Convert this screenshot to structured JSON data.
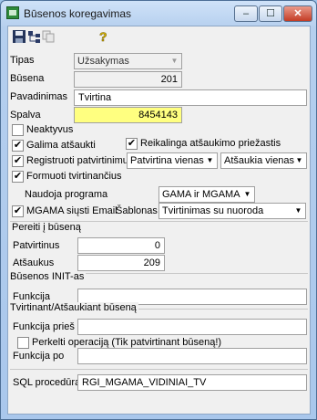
{
  "window": {
    "title": "Būsenos koregavimas",
    "buttons": {
      "minimize": "–",
      "maximize": "☐",
      "close": "✕"
    }
  },
  "toolbar": {
    "icons": [
      "save-icon",
      "tree-icon",
      "copy-icon",
      "help-icon"
    ]
  },
  "form": {
    "tipas_label": "Tipas",
    "tipas_value": "Užsakymas",
    "busena_label": "Būsena",
    "busena_value": "201",
    "pavadinimas_label": "Pavadinimas",
    "pavadinimas_value": "Tvirtina",
    "spalva_label": "Spalva",
    "spalva_value": "8454143",
    "neaktyvus_label": "Neaktyvus",
    "galima_atsaukti_label": "Galima atšaukti",
    "reikalinga_label": "Reikalinga atšaukimo priežastis",
    "registruoti_label": "Registruoti patvirtinimus",
    "registruoti_combo1": "Patvirtina vienas",
    "registruoti_combo2": "Atšaukia vienas",
    "formuoti_label": "Formuoti tvirtinančius",
    "naudoja_label": "Naudoja programa",
    "naudoja_value": "GAMA ir MGAMA",
    "mgama_label": "MGAMA siųsti Email",
    "sablonas_label": "Šablonas",
    "sablonas_value": "Tvirtinimas su nuoroda"
  },
  "pereiti": {
    "title": "Pereiti į būseną",
    "patvirtinus_label": "Patvirtinus",
    "patvirtinus_value": "0",
    "atsaukus_label": "Atšaukus",
    "atsaukus_value": "209"
  },
  "init": {
    "title": "Būsenos INIT-as",
    "funkcija_label": "Funkcija",
    "funkcija_value": ""
  },
  "tvirtinant": {
    "title": "Tvirtinant/Atšaukiant būseną",
    "funkcija_pries_label": "Funkcija prieš",
    "funkcija_pries_value": "",
    "perkelti_label": "Perkelti operaciją (Tik patvirtinant būseną!)",
    "funkcija_po_label": "Funkcija po",
    "funkcija_po_value": ""
  },
  "sql": {
    "label": "SQL procedūra",
    "value": "RGI_MGAMA_VIDINIAI_TV"
  },
  "checks": {
    "neaktyvus": false,
    "galima_atsaukti": true,
    "reikalinga": true,
    "registruoti": true,
    "formuoti": true,
    "mgama": true,
    "perkelti": false
  }
}
